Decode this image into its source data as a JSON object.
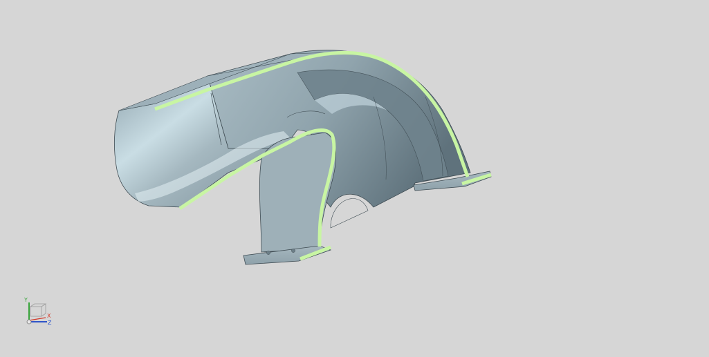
{
  "viewport": {
    "background": "#d6d6d6",
    "model": {
      "type": "sheet-metal-duct-section",
      "surface_color": "#9fb1ba",
      "highlight_color": "#d8e9ef",
      "shadow_color": "#61757f",
      "section_edge_color": "#c8f5a3",
      "edge_line_color": "#3e4b52"
    },
    "triad": {
      "y_label": "Y",
      "x_label": "X",
      "z_label": "Z",
      "y_color": "#38a43a",
      "x_color": "#d23a2a",
      "z_color": "#2f54c9"
    }
  }
}
